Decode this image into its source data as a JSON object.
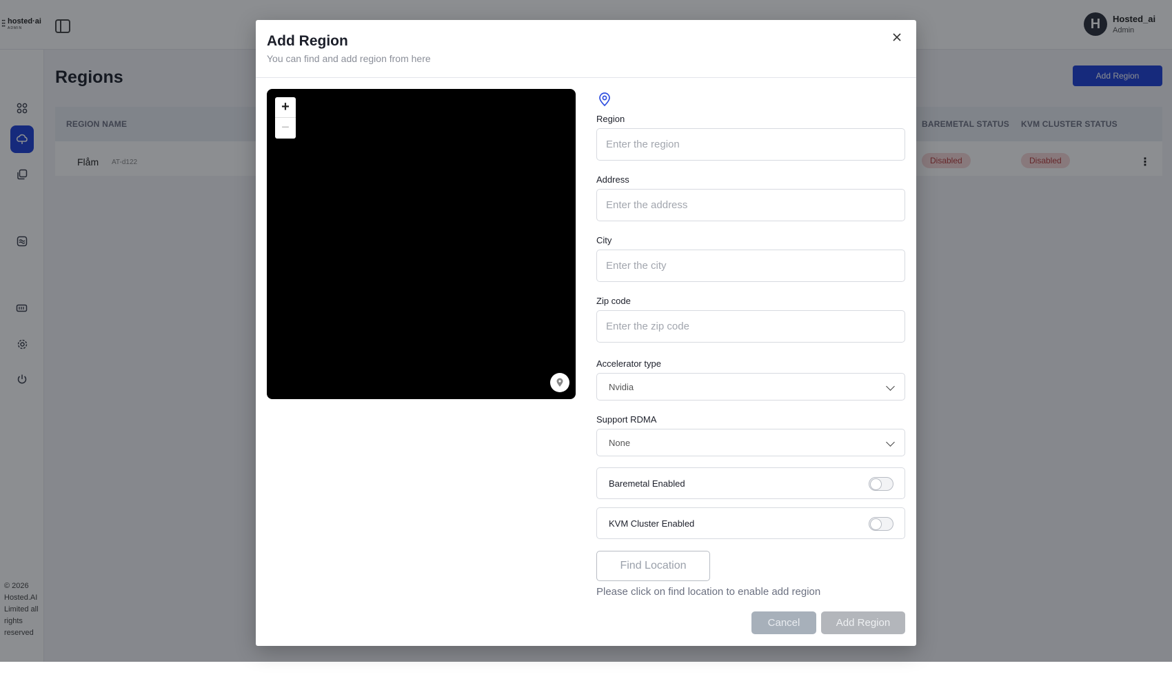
{
  "brand": {
    "mark": "⫶⫶",
    "name": "hosted·ai",
    "sub": "ADMIN"
  },
  "user": {
    "initial": "H",
    "name": "Hosted_ai",
    "role": "Admin"
  },
  "sidebar": {
    "icons": [
      "dashboard-icon",
      "cloud-icon",
      "copy-icon",
      "wave-icon",
      "gpu-icon",
      "gear-icon",
      "power-icon"
    ],
    "footer": "© 2026 Hosted.AI Limited all rights reserved"
  },
  "page": {
    "title": "Regions",
    "add_button": "Add Region",
    "table": {
      "headers": {
        "name": "REGION NAME",
        "baremetal": "BAREMETAL STATUS",
        "kvm": "KVM CLUSTER STATUS"
      },
      "rows": [
        {
          "name": "Flåm",
          "code": "AT-d122",
          "baremetal": "Disabled",
          "kvm": "Disabled"
        }
      ]
    }
  },
  "modal": {
    "title": "Add Region",
    "subtitle": "You can find and add region from here",
    "map": {
      "zoom_in": "+",
      "zoom_out": "−"
    },
    "form": {
      "region": {
        "label": "Region",
        "placeholder": "Enter the region",
        "value": ""
      },
      "address": {
        "label": "Address",
        "placeholder": "Enter the address",
        "value": ""
      },
      "city": {
        "label": "City",
        "placeholder": "Enter the city",
        "value": ""
      },
      "zip": {
        "label": "Zip code",
        "placeholder": "Enter the zip code",
        "value": ""
      },
      "accelerator": {
        "label": "Accelerator type",
        "value": "Nvidia"
      },
      "rdma": {
        "label": "Support RDMA",
        "value": "None"
      },
      "baremetal": {
        "label": "Baremetal Enabled",
        "enabled": false
      },
      "kvm": {
        "label": "KVM Cluster Enabled",
        "enabled": false
      },
      "find_button": "Find Location",
      "hint": "Please click on find location to enable add region"
    },
    "cancel_button": "Cancel",
    "add_button": "Add Region"
  },
  "colors": {
    "accent": "#1e40d6",
    "badge_bg": "#f8d6d6",
    "badge_text": "#b53b3b"
  }
}
